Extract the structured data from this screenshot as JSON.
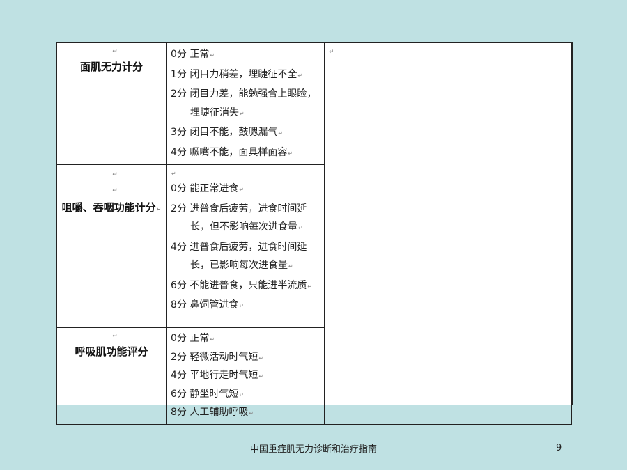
{
  "table": {
    "rows": [
      {
        "category": "面肌无力计分",
        "lines": [
          {
            "text": "0分 正常",
            "indent": false
          },
          {
            "text": "1分 闭目力稍差，埋睫征不全",
            "indent": false
          },
          {
            "text": "2分 闭目力差，能勉强合上眼睑，",
            "indent": false
          },
          {
            "text": "埋睫征消失",
            "indent": true
          },
          {
            "text": "3分 闭目不能，鼓腮漏气",
            "indent": false
          },
          {
            "text": "4分 噘嘴不能，面具样面容",
            "indent": false
          }
        ]
      },
      {
        "category": "咀嚼、吞咽功能计分",
        "lines": [
          {
            "text": "",
            "indent": false
          },
          {
            "text": "0分 能正常进食",
            "indent": false
          },
          {
            "text": "2分 进普食后疲劳，进食时间延",
            "indent": false
          },
          {
            "text": "长，但不影响每次进食量",
            "indent": true
          },
          {
            "text": "4分 进普食后疲劳，进食时间延",
            "indent": false
          },
          {
            "text": "长，已影响每次进食量",
            "indent": true
          },
          {
            "text": "6分 不能进普食，只能进半流质",
            "indent": false
          },
          {
            "text": "8分 鼻饲管进食",
            "indent": false
          }
        ]
      },
      {
        "category": "呼吸肌功能评分",
        "lines": [
          {
            "text": "0分 正常",
            "indent": false
          },
          {
            "text": "2分 轻微活动时气短",
            "indent": false
          },
          {
            "text": "4分 平地行走时气短",
            "indent": false
          },
          {
            "text": "6分 静坐时气短",
            "indent": false
          },
          {
            "text": "8分 人工辅助呼吸",
            "indent": false
          }
        ]
      }
    ],
    "paragraph_mark": "↵"
  },
  "footer": {
    "title": "中国重症肌无力诊断和治疗指南",
    "page_number": "9"
  }
}
